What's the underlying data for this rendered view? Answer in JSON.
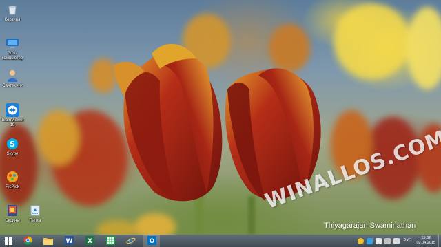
{
  "desktop": {
    "icons": [
      {
        "label": "Корзина",
        "icon": "recycle-bin-icon"
      },
      {
        "label": "Этот компьютер",
        "icon": "this-pc-icon"
      },
      {
        "label": "Сантехник",
        "icon": "user-folder-icon"
      },
      {
        "label": "TeamViewer 10",
        "icon": "teamviewer-icon"
      },
      {
        "label": "Skype",
        "icon": "skype-icon"
      },
      {
        "label": "PicPick",
        "icon": "picpick-icon"
      },
      {
        "label": "Скрины",
        "icon": "screenshots-icon"
      },
      {
        "label": "Папка",
        "icon": "folder-icon"
      }
    ]
  },
  "wallpaper": {
    "watermark": "WINALLOS.COM",
    "credit": "Thiyagarajan Swaminathan"
  },
  "taskbar": {
    "apps": [
      {
        "name": "start-button",
        "icon": "windows-logo-icon"
      },
      {
        "name": "chrome",
        "icon": "chrome-icon"
      },
      {
        "name": "file-explorer",
        "icon": "folder-icon"
      },
      {
        "name": "word",
        "icon": "word-icon"
      },
      {
        "name": "excel",
        "icon": "excel-icon"
      },
      {
        "name": "spreadsheet",
        "icon": "calc-icon"
      },
      {
        "name": "internet-explorer",
        "icon": "ie-icon"
      },
      {
        "name": "outlook",
        "icon": "outlook-icon"
      }
    ],
    "tray": {
      "language": "РУС",
      "time": "15:32",
      "date": "02.04.2015"
    }
  },
  "colors": {
    "taskbar": "#46525a",
    "tulip_red": "#a3231a",
    "tulip_gold": "#e0a020",
    "accent_blue": "#1e90ff"
  }
}
